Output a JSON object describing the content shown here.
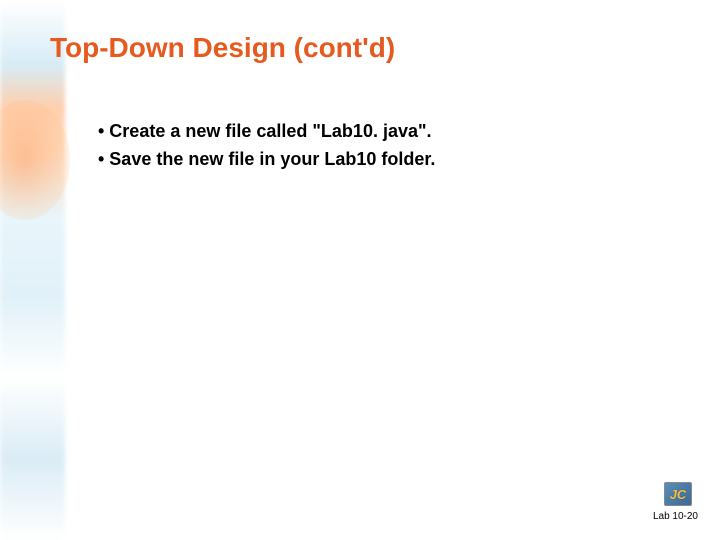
{
  "slide": {
    "title": "Top-Down Design (cont'd)",
    "bullets": [
      "• Create a new file called \"Lab10. java\".",
      "• Save the new file in your Lab10 folder."
    ],
    "logo_text": "JC",
    "footer": "Lab 10-20"
  }
}
